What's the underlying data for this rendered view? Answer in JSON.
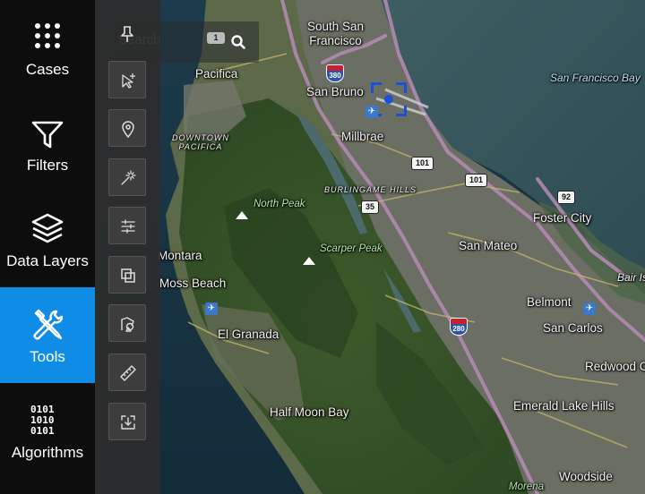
{
  "nav": {
    "items": [
      {
        "label": "Cases",
        "icon": "grid-dots-icon",
        "active": false
      },
      {
        "label": "Filters",
        "icon": "funnel-icon",
        "active": false
      },
      {
        "label": "Data Layers",
        "icon": "layers-icon",
        "active": false
      },
      {
        "label": "Tools",
        "icon": "wrench-screwdriver-icon",
        "active": true
      },
      {
        "label": "Algorithms",
        "icon": "binary-icon",
        "active": false
      }
    ],
    "active_color": "#0f8de6"
  },
  "tools": {
    "pin": "pin-icon",
    "buttons": [
      {
        "name": "select-tool",
        "icon": "cursor-plus-icon"
      },
      {
        "name": "marker-tool",
        "icon": "map-pin-icon"
      },
      {
        "name": "magic-wand-tool",
        "icon": "magic-wand-icon"
      },
      {
        "name": "adjust-tool",
        "icon": "sliders-icon"
      },
      {
        "name": "overlap-tool",
        "icon": "overlap-squares-icon"
      },
      {
        "name": "shape-tool",
        "icon": "shapes-icon"
      },
      {
        "name": "measure-tool",
        "icon": "ruler-icon"
      },
      {
        "name": "download-tool",
        "icon": "download-icon"
      }
    ]
  },
  "search": {
    "placeholder": "Search",
    "badge": "1",
    "icon": "search-icon"
  },
  "map": {
    "places": {
      "south_san_francisco": "South San\nFrancisco",
      "pacifica": "Pacifica",
      "san_bruno": "San Bruno",
      "millbrae": "Millbrae",
      "sf_bay": "San Francisco Bay",
      "downtown_pacifica": "DOWNTOWN\nPACIFICA",
      "burlingame_hills": "BURLINGAME HILLS",
      "north_peak": "North Peak",
      "scarper_peak": "Scarper Peak",
      "foster_city": "Foster City",
      "san_mateo": "San Mateo",
      "montara": "Montara",
      "moss_beach": "Moss Beach",
      "belmont": "Belmont",
      "bair_is": "Bair Is",
      "san_carlos": "San Carlos",
      "el_granada": "El Granada",
      "redwood": "Redwood C",
      "half_moon_bay": "Half Moon Bay",
      "emerald_lake_hills": "Emerald Lake Hills",
      "woodside": "Woodside",
      "morena": "Morena"
    },
    "shields": {
      "i380": "380",
      "us101a": "101",
      "us101b": "101",
      "ca35": "35",
      "ca92": "92",
      "i280": "280"
    }
  }
}
